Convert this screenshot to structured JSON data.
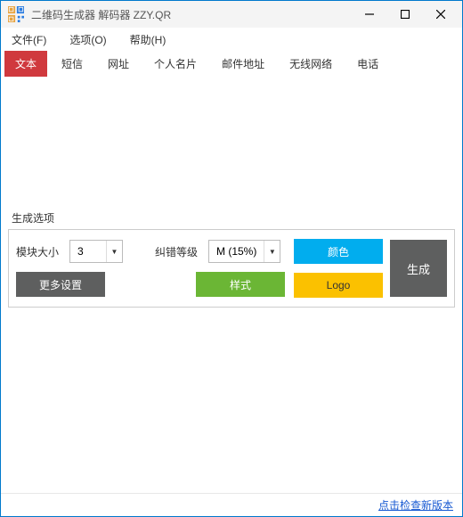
{
  "window": {
    "title": "二维码生成器 解码器 ZZY.QR"
  },
  "menu": {
    "file": "文件(F)",
    "options": "选项(O)",
    "help": "帮助(H)"
  },
  "tabs": {
    "text": "文本",
    "sms": "短信",
    "url": "网址",
    "vcard": "个人名片",
    "email": "邮件地址",
    "wifi": "无线网络",
    "phone": "电话"
  },
  "gen": {
    "section_title": "生成选项",
    "module_size_label": "模块大小",
    "module_size_value": "3",
    "error_level_label": "纠错等级",
    "error_level_value": "M (15%)",
    "more_settings": "更多设置",
    "style": "样式",
    "color": "颜色",
    "logo": "Logo",
    "generate": "生成"
  },
  "footer": {
    "check_update": "点击检查新版本"
  }
}
